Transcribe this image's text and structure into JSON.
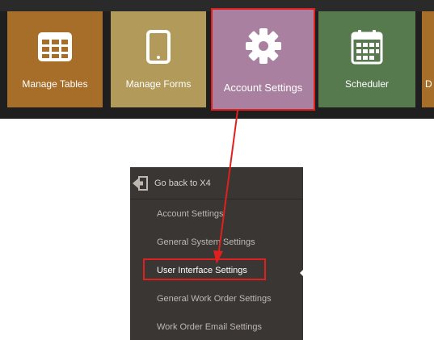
{
  "colors": {
    "tile_tables": "#a66e28",
    "tile_forms": "#b29a5a",
    "tile_account": "#a9809f",
    "tile_scheduler": "#567a4e",
    "tile_edge": "#a66e28",
    "highlight": "#e0201e"
  },
  "tiles": [
    {
      "label": "Manage Tables",
      "icon": "table-grid-icon"
    },
    {
      "label": "Manage Forms",
      "icon": "tablet-icon"
    },
    {
      "label": "Account Settings",
      "icon": "gear-icon"
    },
    {
      "label": "Scheduler",
      "icon": "calendar-icon"
    },
    {
      "label": "D",
      "icon": ""
    }
  ],
  "menu": {
    "back_label": "Go back to X4",
    "back_icon": "exit-arrow-icon",
    "items": [
      {
        "label": "Account Settings"
      },
      {
        "label": "General System Settings"
      },
      {
        "label": "User Interface Settings"
      },
      {
        "label": "General Work Order Settings"
      },
      {
        "label": "Work Order Email Settings"
      }
    ],
    "selected": "User Interface Settings"
  }
}
